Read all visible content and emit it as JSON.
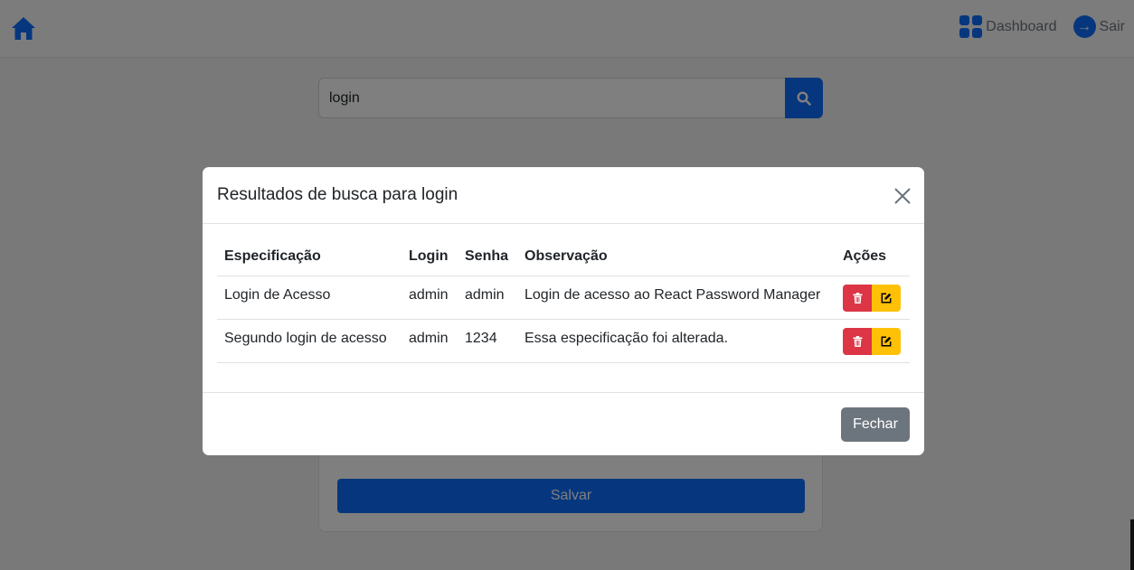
{
  "navbar": {
    "dashboard_label": "Dashboard",
    "logout_label": "Sair"
  },
  "search": {
    "value": "login"
  },
  "form": {
    "save_label": "Salvar"
  },
  "modal": {
    "title": "Resultados de busca para login",
    "columns": [
      "Especificação",
      "Login",
      "Senha",
      "Observação",
      "Ações"
    ],
    "rows": [
      {
        "spec": "Login de Acesso",
        "login": "admin",
        "senha": "admin",
        "obs": "Login de acesso ao React Password Manager"
      },
      {
        "spec": "Segundo login de acesso",
        "login": "admin",
        "senha": "1234",
        "obs": "Essa especificação foi alterada."
      }
    ],
    "close_label": "Fechar"
  },
  "colors": {
    "primary": "#0d6efd",
    "danger": "#dc3545",
    "warning": "#ffc107",
    "secondary": "#6c757d"
  },
  "icons": [
    "home-icon",
    "dashboard-grid-icon",
    "exit-icon",
    "search-icon",
    "close-icon",
    "trash-icon",
    "edit-icon"
  ]
}
